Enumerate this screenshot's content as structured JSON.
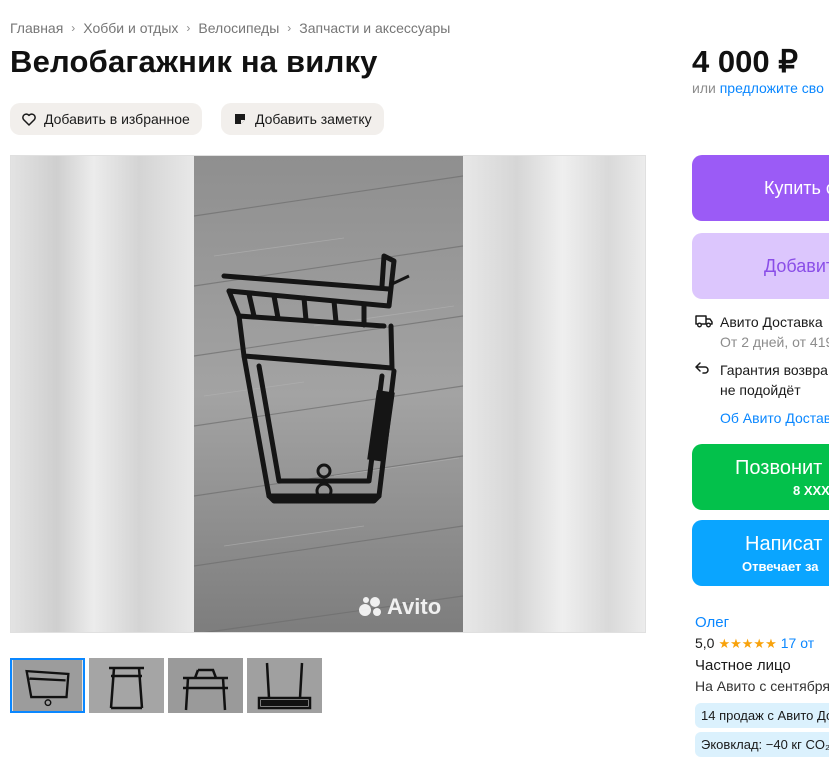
{
  "breadcrumbs": [
    "Главная",
    "Хобби и отдых",
    "Велосипеды",
    "Запчасти и аксессуары"
  ],
  "title": "Велобагажник на вилку",
  "price": "4 000 ₽",
  "offer": {
    "prefix": "или",
    "link": "предложите сво"
  },
  "actions": {
    "favorite": "Добавить в избранное",
    "note": "Добавить заметку"
  },
  "gallery": {
    "watermark": "Avito",
    "thumbnail_count": 4,
    "active_index": 0
  },
  "buy": {
    "label": "Купить с"
  },
  "add_cart": {
    "label": "Добавит"
  },
  "delivery": {
    "title": "Авито Доставка",
    "terms": "От 2 дней, от 419",
    "guarantee_line1": "Гарантия возвра",
    "guarantee_line2": "не подойдёт",
    "about_link": "Об Авито Достав"
  },
  "call": {
    "label": "Позвонит",
    "phone": "8 XXX"
  },
  "write": {
    "label": "Написат",
    "sub": "Отвечает за"
  },
  "seller": {
    "name": "Олег",
    "rating": "5,0",
    "stars": "★★★★★",
    "reviews": "17 от",
    "type": "Частное лицо",
    "since": "На Авито с сентября",
    "tag_sales": "14 продаж с Авито До",
    "tag_eco": "Эковклад: −40 кг CO₂"
  },
  "colors": {
    "accent_blue": "#0a87ff",
    "buy_purple": "#9b5bf6",
    "call_green": "#03c14b",
    "write_blue": "#0aa5ff",
    "star": "#f8a20b"
  }
}
